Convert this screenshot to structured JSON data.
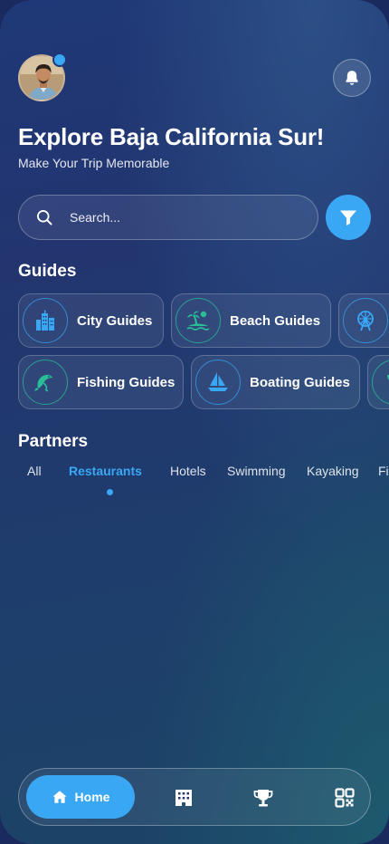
{
  "header": {
    "avatar_icon": "user-avatar",
    "notification_icon": "bell-icon",
    "title": "Explore Baja California Sur!",
    "subtitle": "Make Your Trip Memorable"
  },
  "search": {
    "placeholder": "Search...",
    "value": "",
    "search_icon": "search-icon",
    "filter_icon": "filter-icon"
  },
  "guides": {
    "heading": "Guides",
    "row1": [
      {
        "label": "City Guides",
        "icon": "city-icon"
      },
      {
        "label": "Beach Guides",
        "icon": "beach-icon"
      },
      {
        "label": "",
        "icon": "ferris-wheel-icon"
      }
    ],
    "row2": [
      {
        "label": "Fishing Guides",
        "icon": "fish-icon"
      },
      {
        "label": "Boating Guides",
        "icon": "sailboat-icon"
      },
      {
        "label": "",
        "icon": "plant-icon"
      }
    ]
  },
  "partners": {
    "heading": "Partners",
    "tabs": [
      "All",
      "Restaurants",
      "Hotels",
      "Swimming",
      "Kayaking",
      "Fi"
    ],
    "active_tab": "Restaurants"
  },
  "bottom_nav": {
    "home_label": "Home",
    "items": [
      "home-icon",
      "building-icon",
      "trophy-icon",
      "qr-code-icon"
    ]
  },
  "colors": {
    "accent": "#3aa7f5",
    "teal": "#28be96",
    "background": "#1f3877"
  }
}
